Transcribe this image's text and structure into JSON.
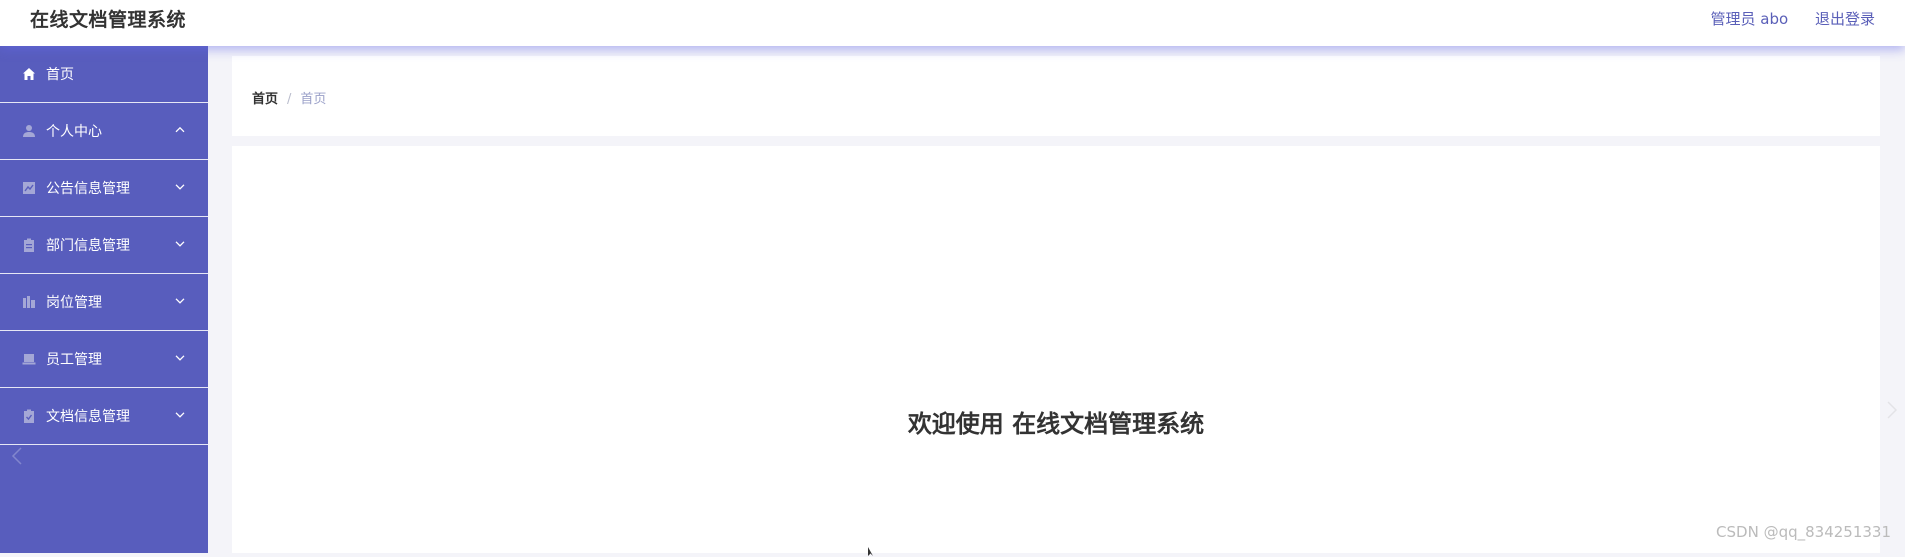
{
  "header": {
    "app_title": "在线文档管理系统",
    "admin_label": "管理员 abo",
    "logout_label": "退出登录"
  },
  "sidebar": {
    "items": [
      {
        "label": "首页",
        "icon": "home-icon"
      },
      {
        "label": "个人中心",
        "icon": "user-icon",
        "expanded": true
      },
      {
        "label": "公告信息管理",
        "icon": "chart-icon"
      },
      {
        "label": "部门信息管理",
        "icon": "clipboard-icon"
      },
      {
        "label": "岗位管理",
        "icon": "building-icon"
      },
      {
        "label": "员工管理",
        "icon": "laptop-icon"
      },
      {
        "label": "文档信息管理",
        "icon": "clipboard-check-icon"
      }
    ]
  },
  "breadcrumb": {
    "home": "首页",
    "separator": "/",
    "current": "首页"
  },
  "main": {
    "welcome_text": "欢迎使用 在线文档管理系统"
  },
  "watermark": "CSDN @qq_834251331",
  "colors": {
    "sidebar_bg": "#585dbd",
    "accent": "#5a5fb8"
  }
}
